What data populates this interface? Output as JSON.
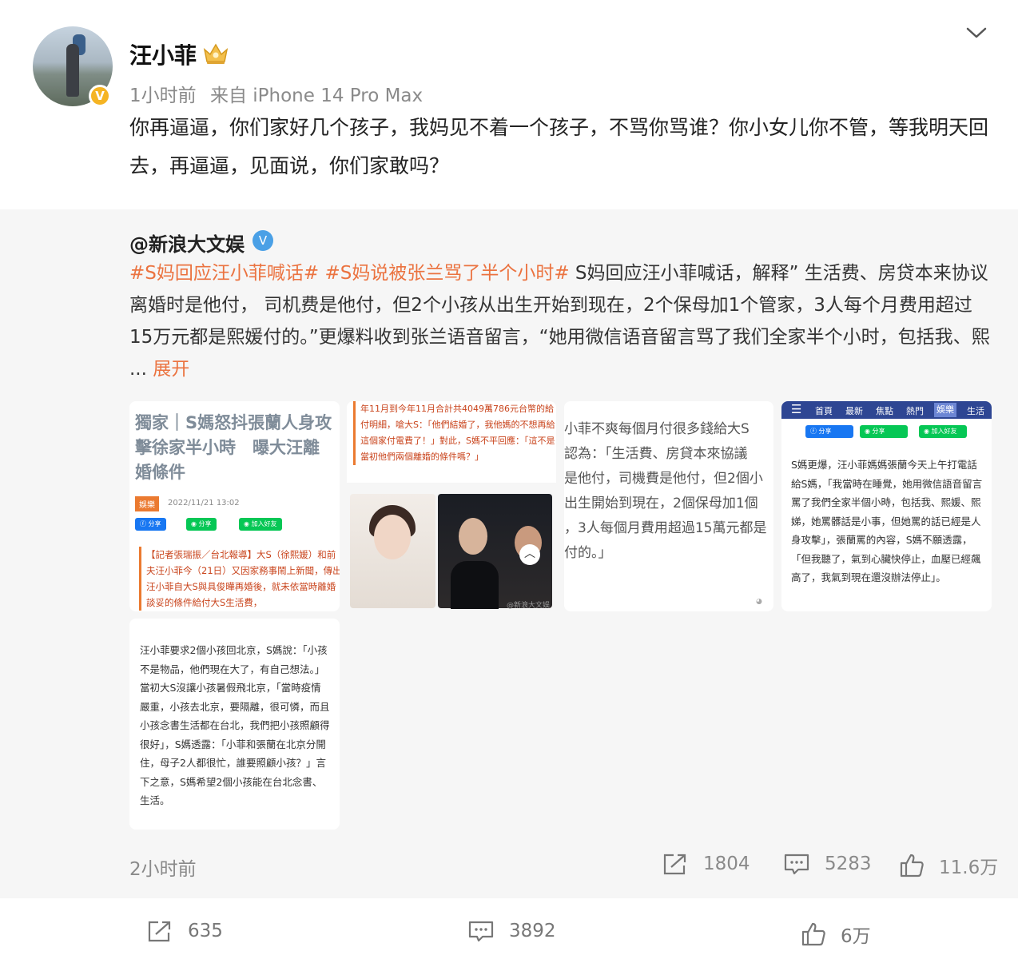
{
  "post": {
    "username": "汪小菲",
    "time": "1小时前",
    "source": "来自 iPhone 14 Pro Max",
    "text": "你再逼逼，你们家好几个孩子，我妈见不着一个孩子，不骂你骂谁？你小女儿你不管，等我明天回去，再逼逼，见面说，你们家敢吗？",
    "icons": {
      "more": "chevron-down-icon",
      "verified": "verified-badge-icon",
      "member": "crown-icon"
    }
  },
  "retweet": {
    "username": "@新浪大文娱",
    "tag1": "#S妈回应汪小菲喊话#",
    "tag2": "#S妈说被张兰骂了半个小时#",
    "text": " S妈回应汪小菲喊话，解释” 生活费、房贷本来协议离婚时是他付， 司机费是他付，但2个小孩从出生开始到现在，2个保母加1个管家，3人每个月费用超过15万元都是熙媛付的。”更爆料收到张兰语音留言，“她用微信语音留言骂了我们全家半个小时，包括我、熙 ... ",
    "expand": "展开",
    "images": {
      "img1": {
        "headline": "獨家｜S媽怒抖張蘭人身攻擊徐家半小時　曝大汪離婚條件",
        "category": "娛樂",
        "date": "2022/11/21 13:02",
        "share_fb": "分享",
        "share_line": "分享",
        "add_friend": "加入好友",
        "lead": "【記者張瑞振／台北報導】大S（徐熙媛）和前夫汪小菲今（21日）又因家務事鬧上新聞，傳出汪小菲自大S與具俊曄再婚後，就未依當時離婚談妥的條件給付大S生活費，"
      },
      "img2": {
        "text": "年11月到今年11月合計共4049萬786元台幣的給付明細，嗆大S：「他們結婚了，我他媽的不想再給這個家付電費了！」對此，S媽不平回應：「這不是當初他們兩個離婚的條件嗎？」",
        "watermark": "@新浪大文娱"
      },
      "img3": {
        "text": "小菲不爽每個月付很多錢給大S\n認為：「生活費、房貸本來協議\n是他付，司機費是他付，但2個小\n出生開始到現在，2個保母加1個\n，3人每個月費用超過15萬元都是\n付的。」"
      },
      "img4": {
        "nav": [
          "首頁",
          "最新",
          "焦點",
          "熱門",
          "娛樂",
          "生活"
        ],
        "share_fb": "分享",
        "share_line": "分享",
        "add_friend": "加入好友",
        "text": "S媽更爆，汪小菲媽媽張蘭今天上午打電話給S媽，「我當時在睡覺，她用微信語音留言罵了我們全家半個小時，包括我、熙媛、熙娣，她罵髒話是小事，但她罵的話已經是人身攻擊」，張蘭罵的內容，S媽不願透露，「但我聽了，氣到心臟快停止，血壓已經飆高了，我氣到現在還沒辦法停止」。"
      },
      "img5": {
        "text": "汪小菲要求2個小孩回北京，S媽說：「小孩不是物品，他們現在大了，有自己想法。」當初大S沒讓小孩暑假飛北京，「當時疫情嚴重，小孩去北京，要隔離，很可憐，而且小孩念書生活都在台北，我們把小孩照顧得很好」，S媽透露：「小菲和張蘭在北京分開住，母子2人都很忙，誰要照顧小孩？」言下之意，S媽希望2個小孩能在台北念書、生活。"
      }
    },
    "time": "2小时前",
    "reposts": "1804",
    "comments": "5283",
    "likes": "11.6万"
  },
  "footer": {
    "reposts": "635",
    "comments": "3892",
    "likes": "6万"
  }
}
